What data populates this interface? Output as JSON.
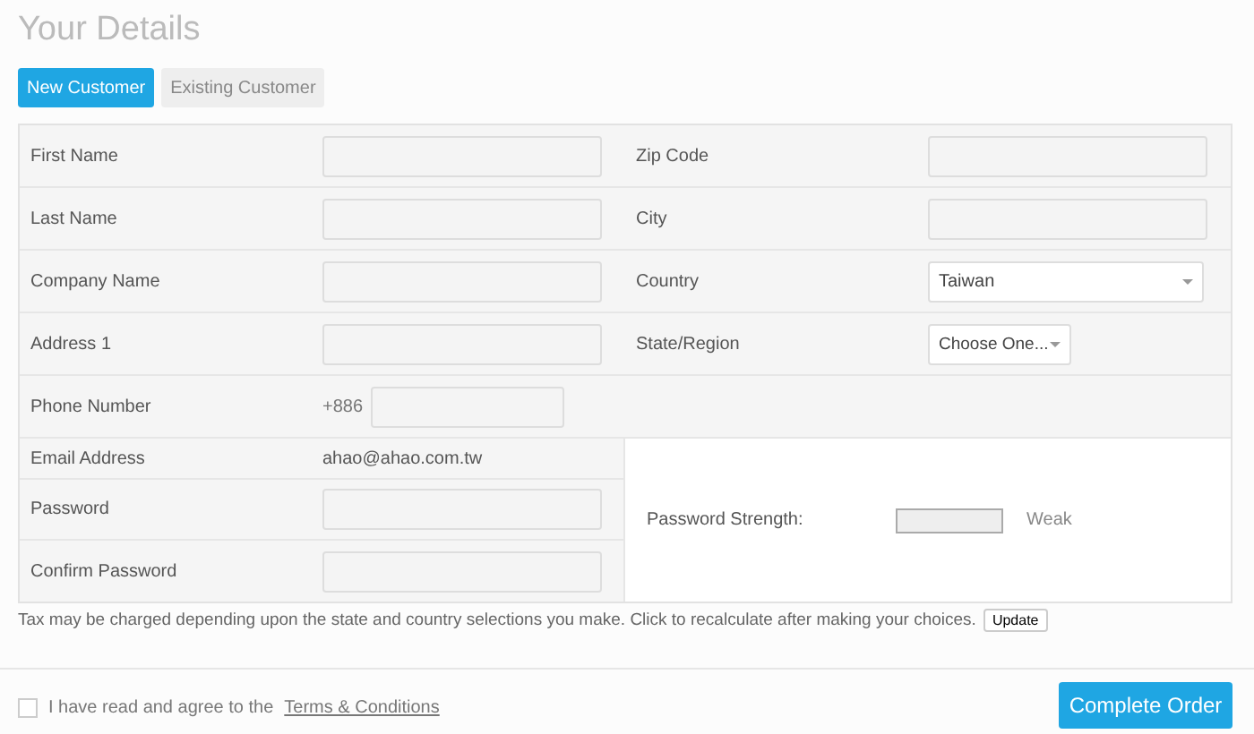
{
  "title": "Your Details",
  "tabs": [
    {
      "label": "New Customer",
      "selected": true
    },
    {
      "label": "Existing Customer",
      "selected": false
    }
  ],
  "rows": [
    [
      {
        "label": "First Name",
        "kind": "input"
      },
      {
        "label": "Zip Code",
        "kind": "input"
      }
    ],
    [
      {
        "label": "Last Name",
        "kind": "input"
      },
      {
        "label": "City",
        "kind": "input"
      }
    ],
    [
      {
        "label": "Company Name",
        "kind": "input"
      },
      {
        "label": "Country",
        "kind": "select",
        "value": "Taiwan"
      }
    ],
    [
      {
        "label": "Address 1",
        "kind": "input"
      },
      {
        "label": "State/Region",
        "kind": "select-small",
        "value": "Choose One..."
      }
    ],
    [
      {
        "label": "Phone Number",
        "kind": "phone",
        "prefix": "+886"
      }
    ]
  ],
  "account": [
    {
      "label": "Email Address",
      "kind": "text",
      "value": "ahao@ahao.com.tw"
    },
    {
      "label": "Password",
      "kind": "input"
    },
    {
      "label": "Confirm Password",
      "kind": "input"
    }
  ],
  "strength": {
    "label": "Password Strength:",
    "level": 0,
    "reading": "Weak"
  },
  "tax_note": "Tax may be charged depending upon the state and country selections you make. Click to recalculate after making your choices.",
  "update_button": "Update",
  "agree": {
    "checked": false,
    "text": "I have read and agree to the",
    "link": "Terms & Conditions"
  },
  "submit": "Complete Order"
}
